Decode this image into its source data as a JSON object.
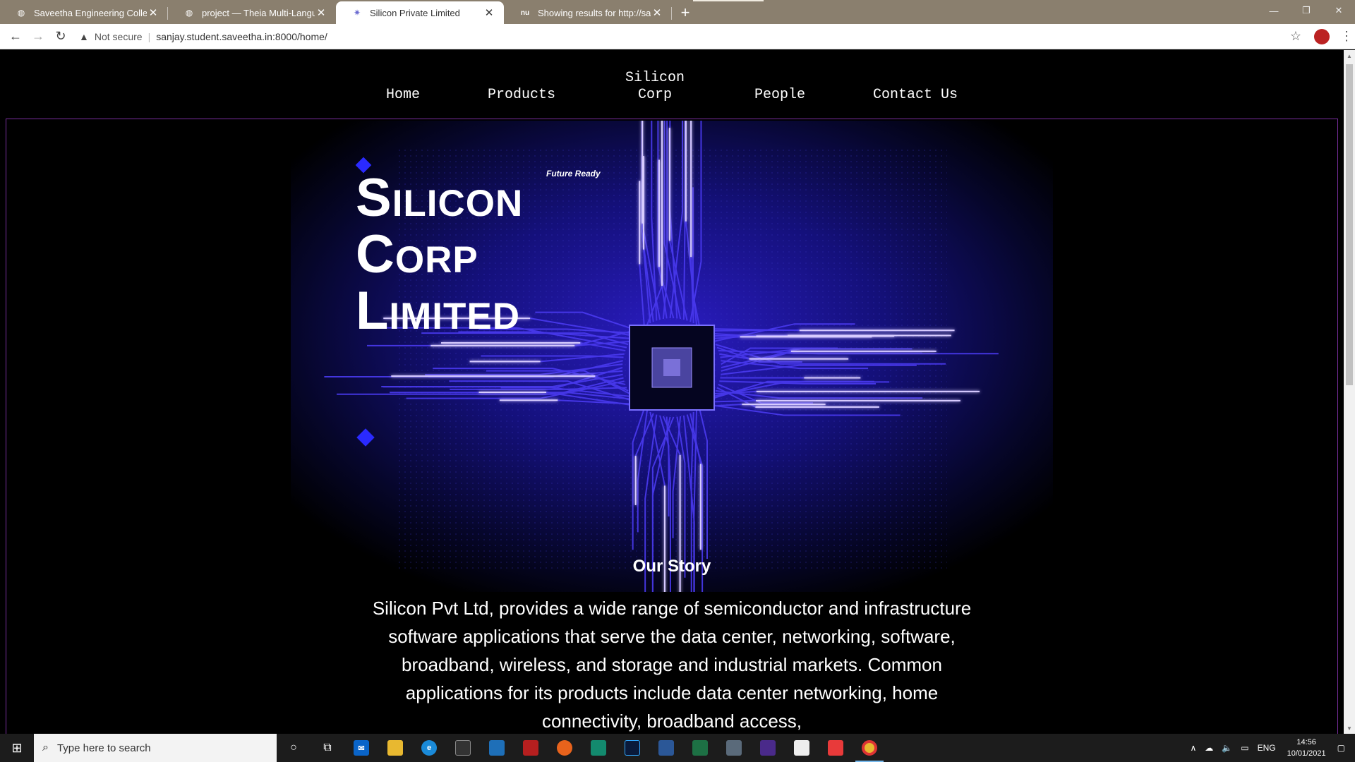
{
  "browser": {
    "tabs": [
      {
        "title": "Saveetha Engineering College",
        "icon": "globe-icon",
        "active": false
      },
      {
        "title": "project — Theia Multi-Language",
        "icon": "globe-icon",
        "active": false
      },
      {
        "title": "Silicon Private Limited",
        "icon": "gear-icon",
        "active": true
      },
      {
        "title": "Showing results for http://sanjay",
        "icon": "nu-icon",
        "active": false
      }
    ],
    "favicon_nu": "nu",
    "new_tab_label": "+",
    "security_label": "Not secure",
    "url": "sanjay.student.saveetha.in:8000/home/"
  },
  "site": {
    "nav": {
      "home": "Home",
      "products": "Products",
      "brand_line1": "Silicon",
      "brand_line2": "Corp",
      "people": "People",
      "contact": "Contact Us"
    },
    "hero": {
      "title_line1": "Silicon",
      "title_line2": "Corp",
      "title_line3": "Limited",
      "tagline": "Future Ready"
    },
    "story": {
      "heading": "Our Story",
      "text": "Silicon Pvt Ltd, provides a wide range of semiconductor and infrastructure software applications that serve the data center, networking, software, broadband, wireless, and storage and industrial markets. Common applications for its products include data center networking, home connectivity, broadband access,"
    }
  },
  "taskbar": {
    "search_placeholder": "Type here to search",
    "language": "ENG",
    "time": "14:56",
    "date": "10/01/2021",
    "pinned": [
      "cortana-icon",
      "task-view-icon",
      "mail-icon",
      "file-explorer-icon",
      "edge-icon",
      "store-icon",
      "photos-icon",
      "acrobat-icon",
      "firefox-icon",
      "sway-icon",
      "photoshop-icon",
      "word-icon",
      "excel-icon",
      "calculator-icon",
      "app-icon",
      "pen-icon",
      "anydesk-icon",
      "chrome-icon"
    ]
  },
  "colors": {
    "tabstrip": "#8a7f6e",
    "frame_border": "#7a2fa0",
    "circuit": "#3a1fd8",
    "glow": "#c8b8ff"
  }
}
